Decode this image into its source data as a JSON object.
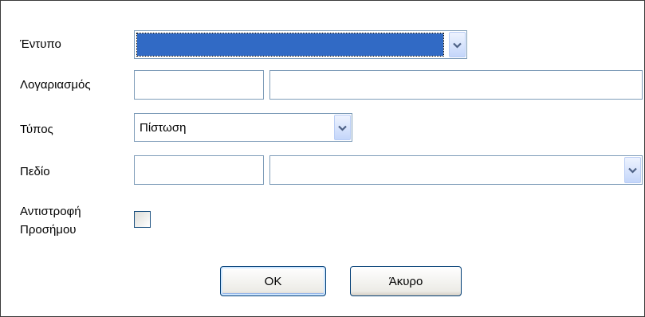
{
  "labels": {
    "form": "Έντυπο",
    "account": "Λογαριασμός",
    "type": "Τύπος",
    "field": "Πεδίο",
    "reverse_sign_line1": "Αντιστροφή",
    "reverse_sign_line2": "Προσήμου"
  },
  "fields": {
    "form_value": "",
    "account_code": "",
    "account_name": "",
    "type_value": "Πίστωση",
    "field_code": "",
    "field_value": "",
    "reverse_sign_checked": false
  },
  "buttons": {
    "ok": "OK",
    "cancel": "Άκυρο"
  },
  "icons": {
    "dropdown": "chevron-down-icon"
  },
  "colors": {
    "selection": "#316ac5",
    "field_border": "#7f9db9",
    "button_border": "#003c74"
  }
}
